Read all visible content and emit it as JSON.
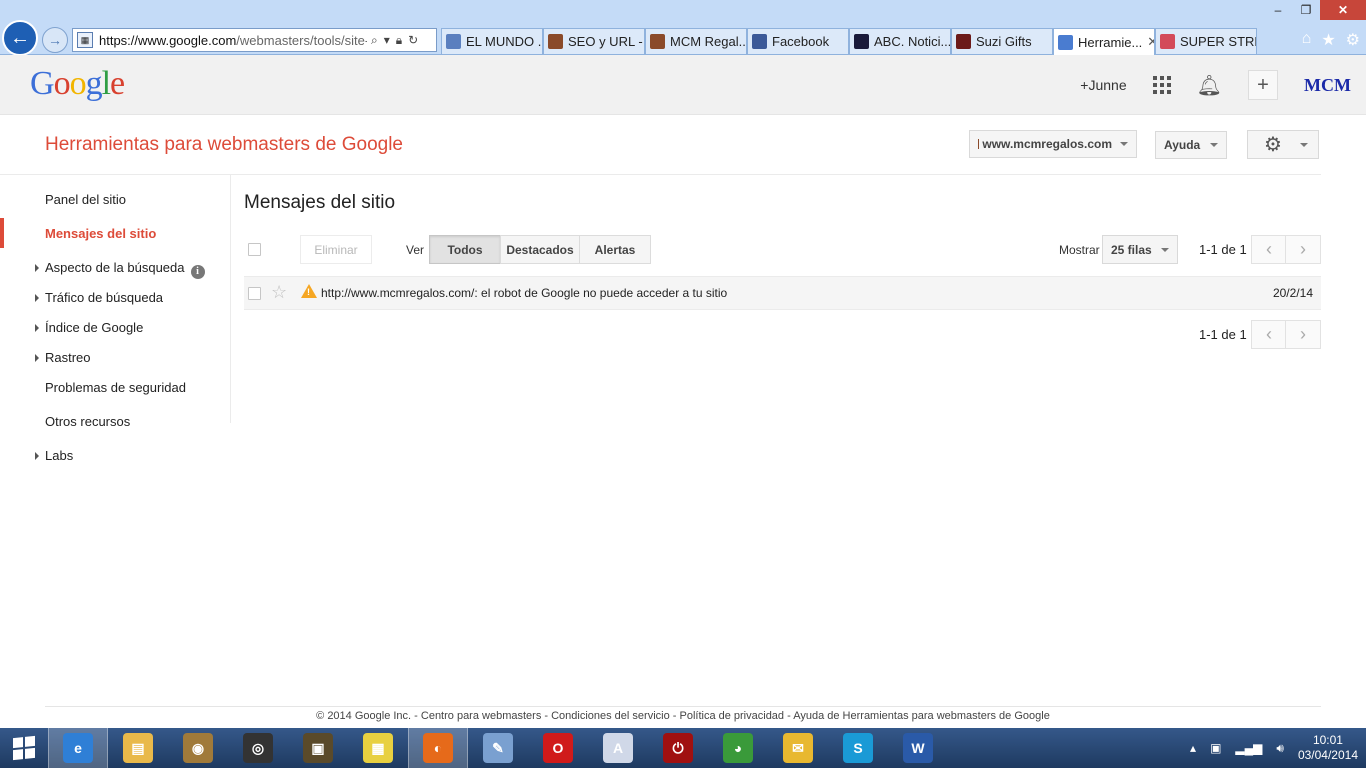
{
  "browser": {
    "url_main": "https://www.google.com",
    "url_rest": "/webmasters/tools/site-m",
    "tabs": [
      {
        "label": "EL MUNDO ...",
        "color": "#5a7fbf"
      },
      {
        "label": "SEO y URL - ...",
        "color": "#8a4a2a"
      },
      {
        "label": "MCM Regal...",
        "color": "#8a4a2a"
      },
      {
        "label": "Facebook",
        "color": "#3b5998"
      },
      {
        "label": "ABC. Notici...",
        "color": "#1a1a3a"
      },
      {
        "label": "Suzi Gifts",
        "color": "#6b1a1a"
      },
      {
        "label": "Herramie...",
        "color": "#4a7cd0"
      },
      {
        "label": "SUPER STRE...",
        "color": "#d34a5a"
      }
    ],
    "window_controls": {
      "minimize": "–",
      "restore": "❐",
      "close": "✕"
    }
  },
  "google_bar": {
    "logo": [
      "G",
      "o",
      "o",
      "g",
      "l",
      "e"
    ],
    "user": "+Junne",
    "avatar_text": "MCM"
  },
  "header": {
    "title": "Herramientas para webmasters de Google",
    "site": "www.mcmregalos.com",
    "help": "Ayuda"
  },
  "sidebar": {
    "items": [
      {
        "label": "Panel del sitio",
        "expandable": false,
        "active": false
      },
      {
        "label": "Mensajes del sitio",
        "expandable": false,
        "active": true
      },
      {
        "label": "Aspecto de la búsqueda",
        "expandable": true,
        "active": false,
        "info": "i"
      },
      {
        "label": "Tráfico de búsqueda",
        "expandable": true,
        "active": false
      },
      {
        "label": "Índice de Google",
        "expandable": true,
        "active": false
      },
      {
        "label": "Rastreo",
        "expandable": true,
        "active": false
      },
      {
        "label": "Problemas de seguridad",
        "expandable": false,
        "active": false
      },
      {
        "label": "Otros recursos",
        "expandable": false,
        "active": false
      },
      {
        "label": "Labs",
        "expandable": true,
        "active": false
      }
    ]
  },
  "main": {
    "title": "Mensajes del sitio",
    "delete_label": "Eliminar",
    "view_label": "Ver",
    "filters": [
      "Todos",
      "Destacados",
      "Alertas"
    ],
    "selected_filter": "Todos",
    "show_label": "Mostrar",
    "rows_option": "25 filas",
    "pager_text": "1-1 de 1",
    "messages": [
      {
        "subject": "http://www.mcmregalos.com/: el robot de Google no puede acceder a tu sitio",
        "date": "20/2/14",
        "type": "warning"
      }
    ]
  },
  "footer": {
    "text": "© 2014 Google Inc. - Centro para webmasters - Condiciones del servicio - Política de privacidad - Ayuda de Herramientas para webmasters de Google"
  },
  "taskbar": {
    "apps": [
      {
        "name": "internet-explorer",
        "color": "#2f7fd6",
        "glyph": "e",
        "active": true
      },
      {
        "name": "file-explorer",
        "color": "#e9b94a",
        "glyph": "▤",
        "active": false
      },
      {
        "name": "media-app",
        "color": "#a07a3a",
        "glyph": "◉",
        "active": false
      },
      {
        "name": "speaker-app",
        "color": "#333333",
        "glyph": "◎",
        "active": false
      },
      {
        "name": "doc-app",
        "color": "#5a4a2a",
        "glyph": "▣",
        "active": false
      },
      {
        "name": "games-app",
        "color": "#e8d040",
        "glyph": "▦",
        "active": false
      },
      {
        "name": "firefox",
        "color": "#e66a1a",
        "glyph": "◐",
        "active": true
      },
      {
        "name": "paint-app",
        "color": "#7aa0d0",
        "glyph": "✎",
        "active": false
      },
      {
        "name": "opera",
        "color": "#d01a1a",
        "glyph": "O",
        "active": false
      },
      {
        "name": "document-app",
        "color": "#d0d8e8",
        "glyph": "A",
        "active": false
      },
      {
        "name": "power-app",
        "color": "#a01010",
        "glyph": "⏻",
        "active": false
      },
      {
        "name": "chrome",
        "color": "#3a9a3a",
        "glyph": "◕",
        "active": false
      },
      {
        "name": "outlook",
        "color": "#e8b830",
        "glyph": "✉",
        "active": false
      },
      {
        "name": "skype",
        "color": "#1a9ad6",
        "glyph": "S",
        "active": false
      },
      {
        "name": "word",
        "color": "#2a5aa8",
        "glyph": "W",
        "active": false
      }
    ],
    "time": "10:01",
    "date": "03/04/2014"
  }
}
